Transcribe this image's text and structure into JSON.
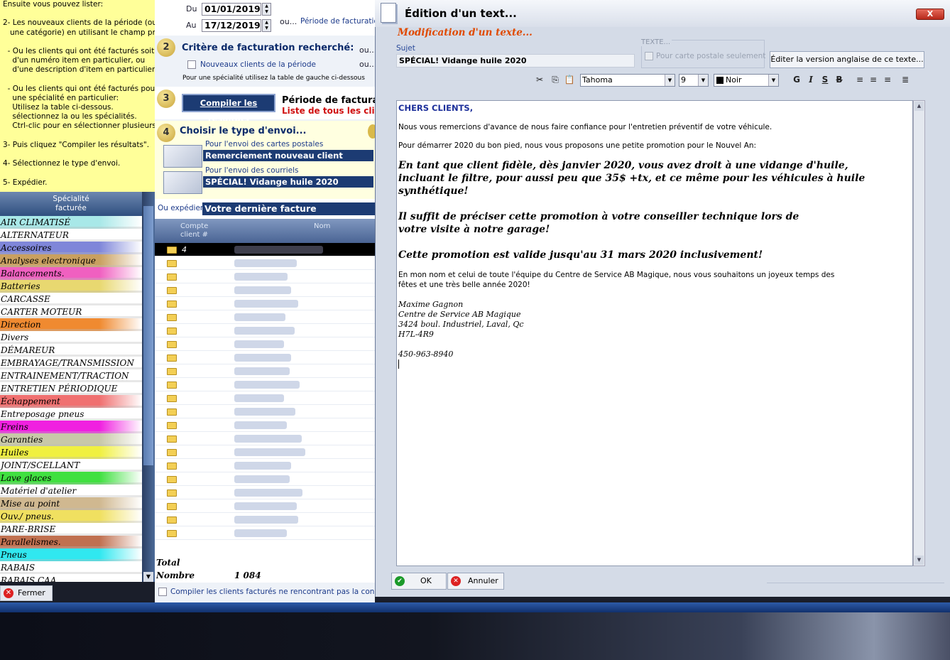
{
  "help_lines": [
    "Ensuite vous pouvez lister:",
    "",
    "2- Les nouveaux clients de la période (ou",
    "   une catégorie) en utilisant le champ prévu.",
    "",
    "  - Ou les clients qui ont été facturés soit:",
    "    d'un numéro item en particulier, ou",
    "    d'une description d'item en particulier.",
    "",
    "  - Ou les clients qui ont été facturés pour",
    "    une spécialité en particulier:",
    "    Utilisez la table ci-dessous.",
    "    sélectionnez la ou les spécialités.",
    "    Ctrl-clic pour en sélectionner plusieurs.",
    "",
    "3- Puis cliquez \"Compiler les résultats\".",
    "",
    "4- Sélectionnez le type d'envoi.",
    "",
    "5- Expédier."
  ],
  "specialites_header": [
    "Spécialité",
    "facturée"
  ],
  "specialites": [
    {
      "label": "AIR CLIMATISÉ",
      "color": "#a8e8e8"
    },
    {
      "label": "ALTERNATEUR",
      "color": "#ffffff"
    },
    {
      "label": "Accessoires",
      "color": "#7f86d9"
    },
    {
      "label": "Analyses electronique",
      "color": "#c9a060"
    },
    {
      "label": "Balancements.",
      "color": "#f060c0"
    },
    {
      "label": "Batteries",
      "color": "#e8d870"
    },
    {
      "label": "CARCASSE",
      "color": "#ffffff"
    },
    {
      "label": "CARTER MOTEUR",
      "color": "#ffffff"
    },
    {
      "label": "Direction",
      "color": "#f08a30"
    },
    {
      "label": "Divers",
      "color": "#ffffff"
    },
    {
      "label": "DÉMAREUR",
      "color": "#ffffff"
    },
    {
      "label": "EMBRAYAGE/TRANSMISSION",
      "color": "#ffffff"
    },
    {
      "label": "ENTRAINEMENT/TRACTION",
      "color": "#ffffff"
    },
    {
      "label": "ENTRETIEN PÉRIODIQUE",
      "color": "#ffffff"
    },
    {
      "label": "Échappement",
      "color": "#f07070"
    },
    {
      "label": "Entreposage pneus",
      "color": "#ffffff"
    },
    {
      "label": "Freins",
      "color": "#f020e0"
    },
    {
      "label": "Garanties",
      "color": "#c8c8a8"
    },
    {
      "label": "Huiles",
      "color": "#f0f040"
    },
    {
      "label": "JOINT/SCELLANT",
      "color": "#ffffff"
    },
    {
      "label": "Lave glaces",
      "color": "#40e040"
    },
    {
      "label": "Matériel d'atelier",
      "color": "#ffffff"
    },
    {
      "label": "Mise au point",
      "color": "#d0b890"
    },
    {
      "label": "Ouv./ pneus.",
      "color": "#f0e060"
    },
    {
      "label": "PARE-BRISE",
      "color": "#ffffff"
    },
    {
      "label": "Parallelismes.",
      "color": "#c07050"
    },
    {
      "label": "Pneus",
      "color": "#30e8f0"
    },
    {
      "label": "RABAIS",
      "color": "#ffffff"
    },
    {
      "label": "RABAIS CAA",
      "color": "#ffffff"
    }
  ],
  "fermer_label": "Fermer",
  "dates": {
    "du_label": "Du",
    "du_value": "01/01/2019",
    "au_label": "Au",
    "au_value": "17/12/2019",
    "ou_label": "ou...",
    "periode_link": "Période de facturation"
  },
  "step2": {
    "num": "2",
    "title": "Critère de facturation recherché:",
    "check_label": "Nouveaux clients de la période",
    "note": "Pour une spécialité utilisez la table de gauche ci-dessous",
    "ou1": "ou...",
    "ou2": "ou..."
  },
  "step3": {
    "num": "3",
    "button": "Compiler les résultats",
    "periode": "Période de facturatio",
    "liste": "Liste de tous les clien"
  },
  "step4": {
    "num": "4",
    "title": "Choisir le type d'envoi...",
    "postal_link": "Pour l'envoi des cartes postales",
    "postal_selected": "Remerciement nouveau client",
    "courriel_link": "Pour l'envoi des courriels",
    "courriel_selected": "SPÉCIAL! Vidange huile 2020",
    "expedier_label": "Ou expédier",
    "expedier_value": "Votre dernière facture"
  },
  "grid": {
    "col1": [
      "Compte",
      "client #"
    ],
    "col2": "Nom",
    "first_row_value": "4",
    "row_count": 22
  },
  "totals": {
    "total_label": "Total",
    "nombre_label": "Nombre",
    "nombre_value": "1 084"
  },
  "compiler_check": "Compiler les clients facturés ne rencontrant pas la condition",
  "dialog": {
    "title": "Édition d'un text...",
    "close": "X",
    "heading": "Modification d'un texte...",
    "sujet_label": "Sujet",
    "sujet_value": "SPÉCIAL! Vidange huile 2020",
    "texte_label": "TEXTE...",
    "postale_label": "Pour carte postale seulement",
    "anglais_button": "Éditer la version anglaise de ce texte...",
    "font": "Tahoma",
    "size": "9",
    "color": "Noir",
    "ok": "OK",
    "annuler": "Annuler"
  },
  "body_text": {
    "hdr": "CHERS CLIENTS,",
    "p1": "Nous vous remercions d'avance de nous faire confiance pour l'entretien préventif de votre véhicule.",
    "p2": "Pour démarrer 2020 du bon pied, nous vous proposons une petite promotion pour le Nouvel An:",
    "b1": "En tant que client fidèle, dès janvier 2020, vous avez droit à une vidange d'huile,\nincluant le filtre, pour aussi peu que 35$ +tx, et ce même pour les véhicules à huile\nsynthétique!",
    "b2": "Il suffit de préciser cette promotion à votre conseiller technique lors de\nvotre visite à notre garage!",
    "b3": "Cette promotion est valide jusqu'au 31 mars 2020 inclusivement!",
    "p3": "En mon nom et celui de toute l'équipe du Centre de Service AB Magique, nous vous souhaitons un joyeux temps des\nfêtes et une très belle année 2020!",
    "sig": "Maxime Gagnon\nCentre de Service AB Magique\n3424 boul. Industriel, Laval, Qc\nH7L-4R9\n\n450-963-8940"
  },
  "colors": {
    "accent_title": "#e04a00",
    "link": "#1c3a8a",
    "selected_bg": "#1c3b73",
    "help_bg": "#ffff99"
  }
}
